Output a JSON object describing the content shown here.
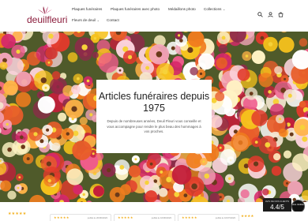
{
  "header": {
    "logo_text": "deuilfleuri",
    "nav": {
      "item1": "Plaques funéraires",
      "item2": "Plaques funéraires avec photo",
      "item3": "Médaillons photo",
      "item4": "Collections",
      "item5": "Fleurs de deuil",
      "item6": "Contact"
    },
    "icons": [
      "search-icon",
      "account-icon",
      "cart-icon"
    ]
  },
  "hero": {
    "title": "Articles funéraires depuis 1975",
    "text": "Depuis de nombreuses années, Deuil Fleuri vous conseille et vous accompagne pour rendre le plus beau des hommages à vos proches."
  },
  "reviews_badge": {
    "title": "AVIS DE NOS CLIENTS",
    "score": "4.4/5",
    "stars": "★★★★★",
    "seal": "Avis Vérifiés"
  },
  "review_strip": {
    "left_stars": "★★★★★",
    "review1": {
      "stars": "★★★★★",
      "date": "publié le 20/06/2023"
    },
    "review2": {
      "stars": "★★★★★",
      "date": "publié le 16/06/2023"
    },
    "review3": {
      "stars": "★★★★★",
      "date": "publié le 16/07/2023"
    },
    "right_stars": "★★★★"
  },
  "colors": {
    "brand": "#8a1a3a",
    "star": "#f2b01e"
  }
}
